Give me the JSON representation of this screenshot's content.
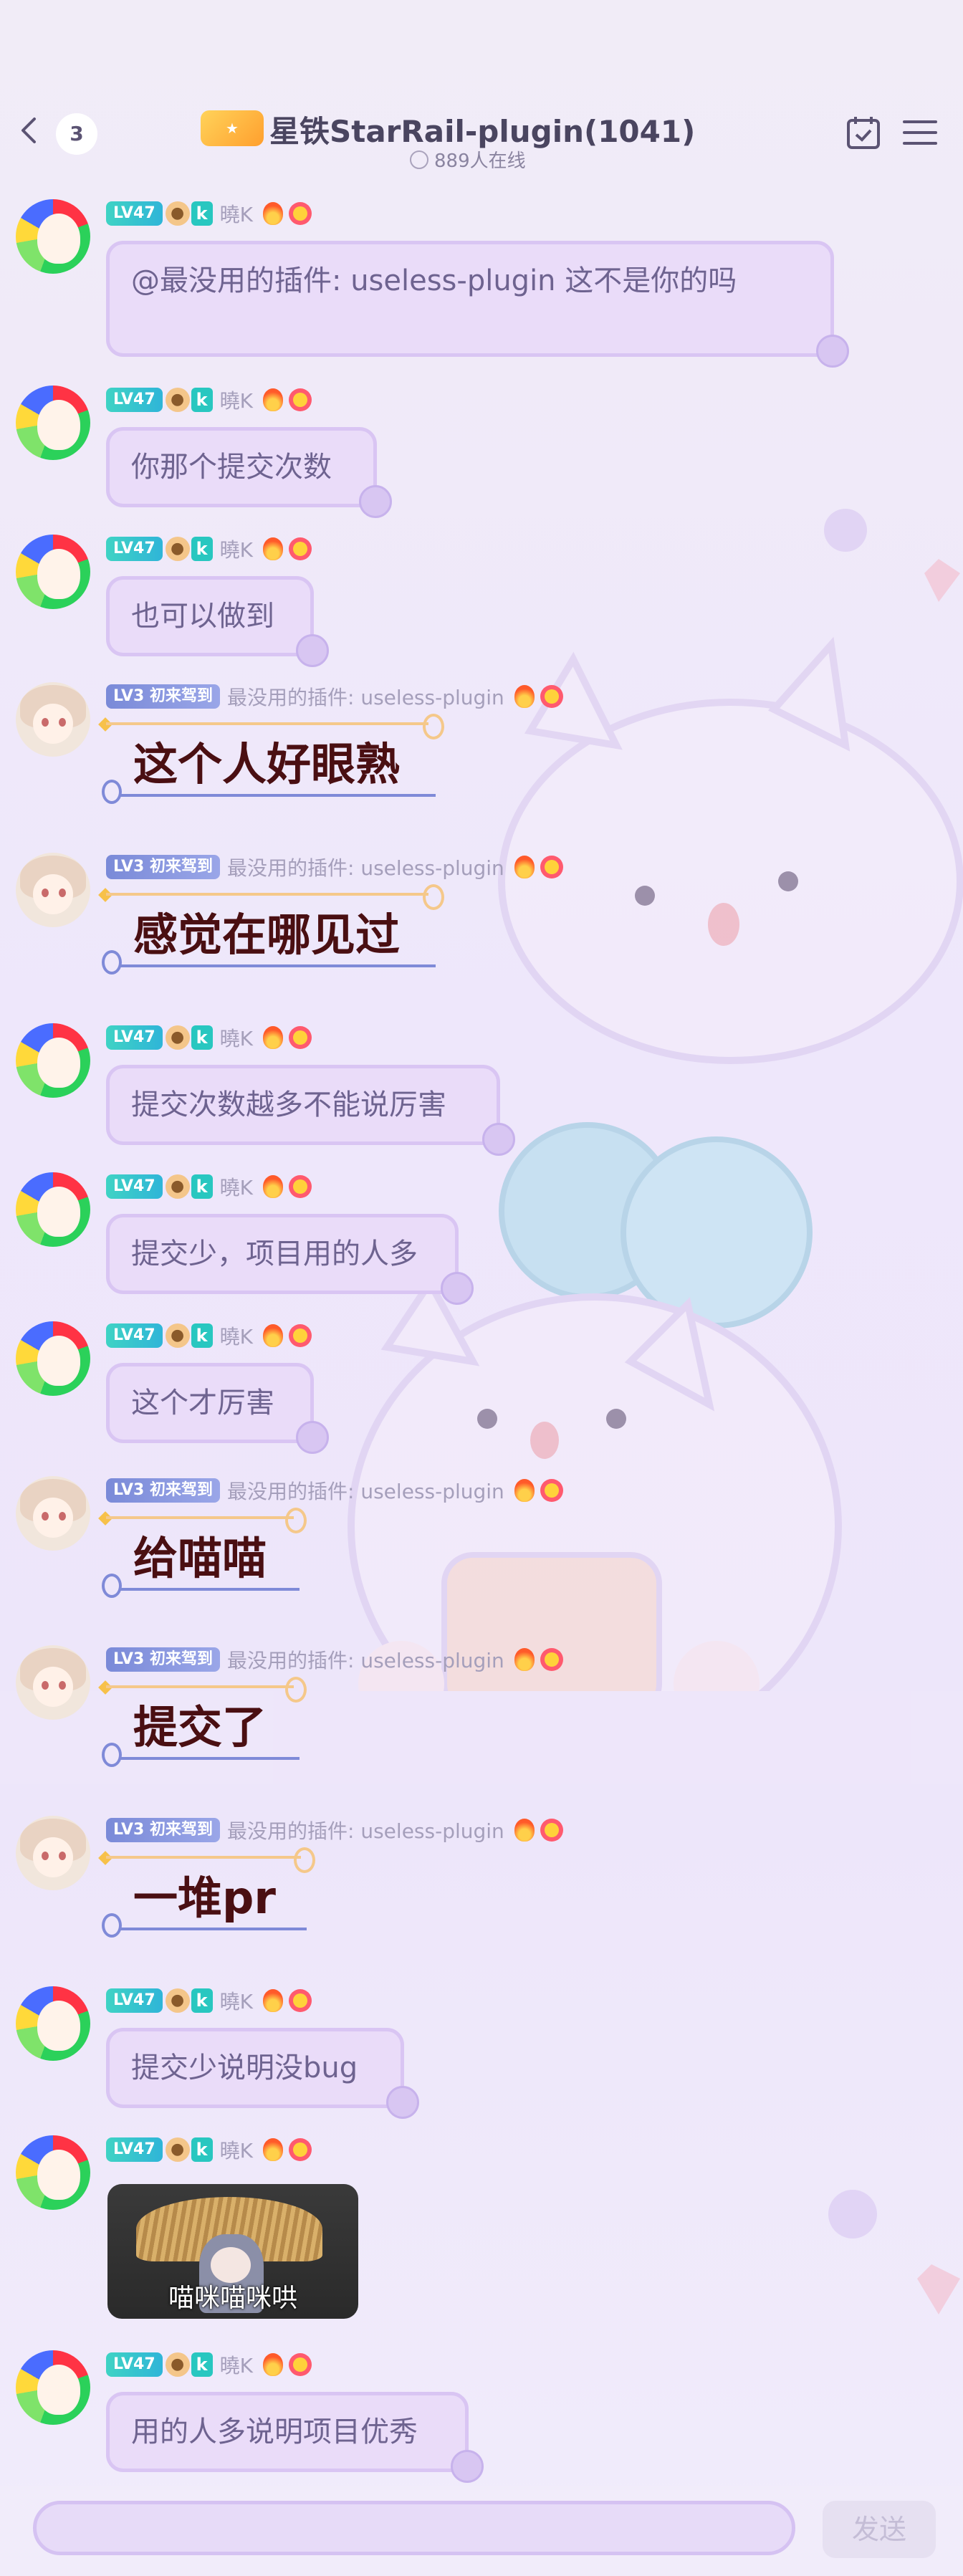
{
  "header": {
    "unread_count": "3",
    "title": "星铁StarRail-plugin(1041)",
    "online": "889人在线",
    "logo_icon": "group-logo-icon"
  },
  "users": {
    "k": {
      "name": "曉K",
      "level": "LV47",
      "badge": "k"
    },
    "g": {
      "name": "最没用的插件: useless-plugin",
      "level": "LV3",
      "tag": "初来驾到"
    }
  },
  "messages": [
    {
      "text": "@最没用的插件: useless-plugin 这不是你的吗"
    },
    {
      "text": "你那个提交次数"
    },
    {
      "text": "也可以做到"
    },
    {
      "text": "这个人好眼熟"
    },
    {
      "text": "感觉在哪见过"
    },
    {
      "text": "提交次数越多不能说厉害"
    },
    {
      "text": "提交少，项目用的人多"
    },
    {
      "text": "这个才厉害"
    },
    {
      "text": "给喵喵"
    },
    {
      "text": "提交了"
    },
    {
      "text": "一堆pr"
    },
    {
      "text": "提交少说明没bug"
    },
    {
      "caption": "喵咪喵咪哄"
    },
    {
      "text": "用的人多说明项目优秀"
    }
  ],
  "input": {
    "send_label": "发送"
  },
  "colors": {
    "bubble_bg": "#eadcf9",
    "bubble_border": "#d9c5f3",
    "big_text": "#4a0f12",
    "accent_teal": "#2fb5d8"
  }
}
